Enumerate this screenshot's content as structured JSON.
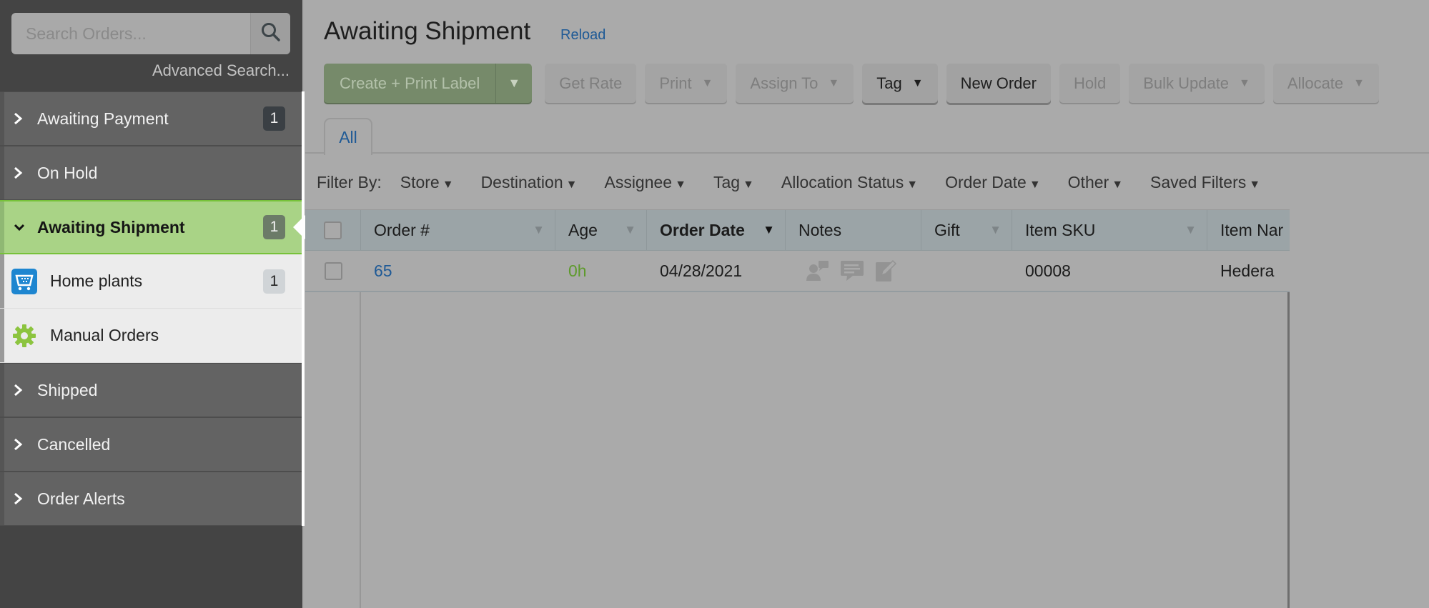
{
  "sidebar": {
    "search": {
      "placeholder": "Search Orders...",
      "value": ""
    },
    "advanced_search": "Advanced Search...",
    "statuses": [
      {
        "label": "Awaiting Payment",
        "count": "1",
        "expanded": false
      },
      {
        "label": "On Hold",
        "count": "",
        "expanded": false
      },
      {
        "label": "Awaiting Shipment",
        "count": "1",
        "expanded": true,
        "stores": [
          {
            "label": "Home plants",
            "count": "1",
            "icon": "cart-store-icon"
          },
          {
            "label": "Manual Orders",
            "count": "",
            "icon": "gear-icon"
          }
        ]
      },
      {
        "label": "Shipped",
        "count": "",
        "expanded": false
      },
      {
        "label": "Cancelled",
        "count": "",
        "expanded": false
      },
      {
        "label": "Order Alerts",
        "count": "",
        "expanded": false
      }
    ]
  },
  "header": {
    "title": "Awaiting Shipment",
    "reload": "Reload"
  },
  "toolbar": {
    "create_print_label": "Create + Print Label",
    "get_rate": "Get Rate",
    "print": "Print",
    "assign_to": "Assign To",
    "tag": "Tag",
    "new_order": "New Order",
    "hold": "Hold",
    "bulk_update": "Bulk Update",
    "allocate": "Allocate"
  },
  "tabs": [
    {
      "label": "All",
      "active": true
    }
  ],
  "filters": {
    "label": "Filter By:",
    "items": [
      "Store",
      "Destination",
      "Assignee",
      "Tag",
      "Allocation Status",
      "Order Date",
      "Other",
      "Saved Filters"
    ]
  },
  "grid": {
    "columns": [
      "Order #",
      "Age",
      "Order Date",
      "Notes",
      "Gift",
      "Item SKU",
      "Item Nar"
    ],
    "sorted_column": "Order Date",
    "rows": [
      {
        "order_number": "65",
        "age": "0h",
        "order_date": "04/28/2021",
        "notes_icons": [
          "customer-note-icon",
          "internal-note-icon",
          "edit-note-icon"
        ],
        "gift": "",
        "item_sku": "00008",
        "item_name": "Hedera"
      }
    ]
  },
  "colors": {
    "active_status_bg": "#a9d386",
    "active_status_border": "#77c23a",
    "link_blue": "#1f5a96",
    "age_green": "#5e9a2c",
    "primary_button": "#768a6a"
  }
}
